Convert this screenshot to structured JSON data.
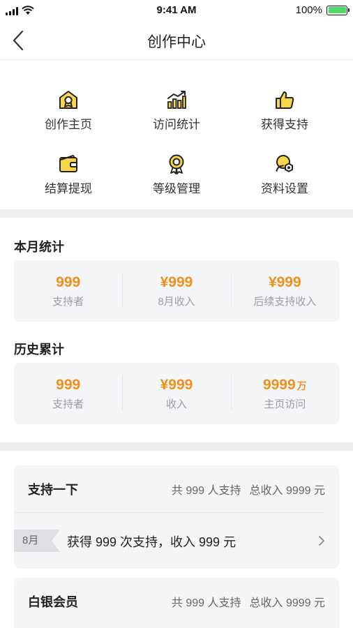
{
  "status_bar": {
    "time": "9:41 AM",
    "battery": "100%"
  },
  "nav": {
    "title": "创作中心"
  },
  "grid": [
    {
      "label": "创作主页",
      "icon": "home-badge-icon"
    },
    {
      "label": "访问统计",
      "icon": "bar-chart-icon"
    },
    {
      "label": "获得支持",
      "icon": "thumbs-up-icon"
    },
    {
      "label": "结算提现",
      "icon": "wallet-icon"
    },
    {
      "label": "等级管理",
      "icon": "medal-icon"
    },
    {
      "label": "资料设置",
      "icon": "settings-icon"
    }
  ],
  "monthly": {
    "title": "本月统计",
    "stats": [
      {
        "value": "999",
        "unit": "",
        "label": "支持者"
      },
      {
        "value": "¥999",
        "unit": "",
        "label": "8月收入"
      },
      {
        "value": "¥999",
        "unit": "",
        "label": "后续支持收入"
      }
    ]
  },
  "history": {
    "title": "历史累计",
    "stats": [
      {
        "value": "999",
        "unit": "",
        "label": "支持者"
      },
      {
        "value": "¥999",
        "unit": "",
        "label": "收入"
      },
      {
        "value": "9999",
        "unit": "万",
        "label": "主页访问"
      }
    ]
  },
  "tiers": [
    {
      "name": "支持一下",
      "supporters": "共 999 人支持",
      "income": "总收入 9999 元",
      "row": {
        "month": "8月",
        "text": "获得 999 次支持，收入 999 元"
      }
    },
    {
      "name": "白银会员",
      "supporters": "共 999 人支持",
      "income": "总收入 9999 元"
    }
  ],
  "colors": {
    "accent": "#f0901c",
    "icon_yellow": "#f8d64a",
    "divider": "#eeeeee",
    "card": "#f4f5f7"
  }
}
